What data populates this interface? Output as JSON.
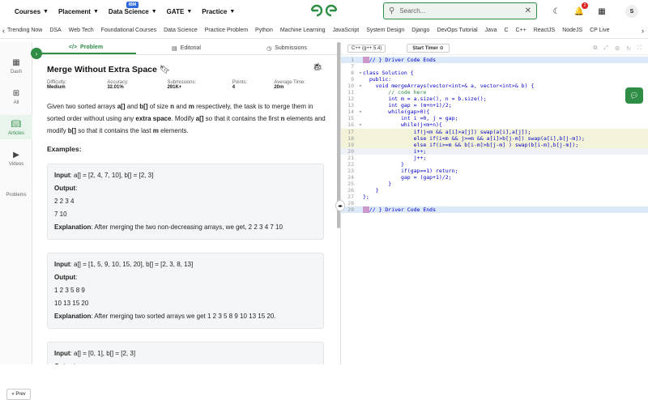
{
  "topnav": {
    "items": [
      "Courses",
      "Placement",
      "Data Science",
      "GATE",
      "Practice"
    ],
    "ibm_badge": "IBM",
    "search_placeholder": "Search...",
    "notif_count": "2",
    "avatar_letter": "S"
  },
  "catbar": {
    "items": [
      "Trending Now",
      "DSA",
      "Web Tech",
      "Foundational Courses",
      "Data Science",
      "Practice Problem",
      "Python",
      "Machine Learning",
      "JavaScript",
      "System Design",
      "Django",
      "DevOps Tutorial",
      "Java",
      "C",
      "C++",
      "ReactJS",
      "NodeJS",
      "CP Live"
    ]
  },
  "sidenav": {
    "items": [
      {
        "label": "Dash",
        "icon": "dashboard-icon"
      },
      {
        "label": "All",
        "icon": "grid-icon"
      },
      {
        "label": "Articles",
        "icon": "book-icon"
      },
      {
        "label": "Videos",
        "icon": "video-icon"
      },
      {
        "label": "Problems",
        "icon": "code-icon"
      }
    ],
    "prev_label": "« Prev"
  },
  "tabs": [
    "Problem",
    "Editorial",
    "Submissions"
  ],
  "problem": {
    "title": "Merge Without Extra Space",
    "meta": [
      {
        "label": "Difficulty: ",
        "value": "Medium"
      },
      {
        "label": "Accuracy: ",
        "value": "32.01%"
      },
      {
        "label": "Submissions: ",
        "value": "291K+"
      },
      {
        "label": "Points: ",
        "value": "4"
      },
      {
        "label": "Average Time: ",
        "value": "20m"
      }
    ],
    "examples_heading": "Examples:",
    "examples": [
      {
        "input": "a[] = [2, 4, 7, 10], b[] = [2, 3]",
        "output1": "2 2 3 4",
        "output2": "7 10",
        "explanation": "After merging the two non-decreasing arrays, we get, 2 2 3 4 7 10"
      },
      {
        "input": "a[] = [1, 5, 9, 10, 15, 20], b[] = [2, 3, 8, 13]",
        "output1": "1 2 3 5 8 9",
        "output2": "10 13 15 20",
        "explanation": "After merging two sorted arrays we get 1 2 3 5 8 9 10 13 15 20."
      },
      {
        "input": "a[] = [0, 1], b[] = [2, 3]",
        "output1": "",
        "output2": "",
        "explanation": ""
      }
    ],
    "labels": {
      "input": "Input",
      "output": "Output",
      "explanation": "Explanation"
    }
  },
  "editor": {
    "language": "C++ (g++ 5.4)",
    "timer_label": "Start Timer",
    "lines": [
      {
        "n": "1",
        "text": "// } Driver Code Ends",
        "tag": true,
        "hl": "blue"
      },
      {
        "n": "7",
        "text": ""
      },
      {
        "n": "8",
        "text": "class Solution {",
        "fold": true
      },
      {
        "n": "9",
        "text": "  public:"
      },
      {
        "n": "10",
        "text": "    void mergeArrays(vector<int>& a, vector<int>& b) {",
        "fold": true
      },
      {
        "n": "11",
        "text": "        // code here",
        "cm": true
      },
      {
        "n": "12",
        "text": "        int m = a.size(), n = b.size();"
      },
      {
        "n": "13",
        "text": "        int gap = (m+n+1)/2;"
      },
      {
        "n": "14",
        "text": "        while(gap>0){",
        "fold": true
      },
      {
        "n": "15",
        "text": "            int i =0, j = gap;"
      },
      {
        "n": "16",
        "text": "            while(j<m+n){",
        "fold": true
      },
      {
        "n": "17",
        "text": "                if(j<m && a[i]>a[j]) swap(a[i],a[j]);",
        "sel": true
      },
      {
        "n": "18",
        "text": "                else if(i<m && j>=m && a[i]>b[j-m]) swap(a[i],b[j-m]);",
        "sel": true
      },
      {
        "n": "19",
        "text": "                else if(i>=m && b[i-m]>b[j-m] ) swap(b[i-m],b[j-m]);",
        "sel": true
      },
      {
        "n": "20",
        "text": "                i++;",
        "cur": true
      },
      {
        "n": "21",
        "text": "                j++;"
      },
      {
        "n": "22",
        "text": "            }"
      },
      {
        "n": "23",
        "text": "            if(gap==1) return;"
      },
      {
        "n": "24",
        "text": "            gap = (gap+1)/2;"
      },
      {
        "n": "25",
        "text": "        }"
      },
      {
        "n": "26",
        "text": "    }"
      },
      {
        "n": "27",
        "text": "};"
      },
      {
        "n": "28",
        "text": ""
      },
      {
        "n": "29",
        "text": "// } Driver Code Ends",
        "tag": true,
        "hl": "blue"
      }
    ]
  }
}
